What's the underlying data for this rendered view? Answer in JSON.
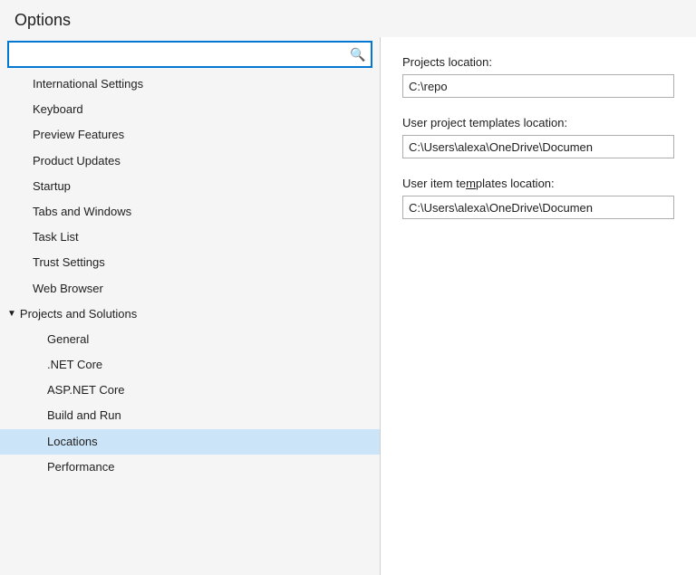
{
  "dialog": {
    "title": "Options"
  },
  "search": {
    "placeholder": "",
    "value": "",
    "icon": "🔍"
  },
  "tree": {
    "items": [
      {
        "id": "international-settings",
        "label": "International Settings",
        "level": "root",
        "selected": false
      },
      {
        "id": "keyboard",
        "label": "Keyboard",
        "level": "root",
        "selected": false
      },
      {
        "id": "preview-features",
        "label": "Preview Features",
        "level": "root",
        "selected": false
      },
      {
        "id": "product-updates",
        "label": "Product Updates",
        "level": "root",
        "selected": false
      },
      {
        "id": "startup",
        "label": "Startup",
        "level": "root",
        "selected": false
      },
      {
        "id": "tabs-and-windows",
        "label": "Tabs and Windows",
        "level": "root",
        "selected": false
      },
      {
        "id": "task-list",
        "label": "Task List",
        "level": "root",
        "selected": false
      },
      {
        "id": "trust-settings",
        "label": "Trust Settings",
        "level": "root",
        "selected": false
      },
      {
        "id": "web-browser",
        "label": "Web Browser",
        "level": "root",
        "selected": false
      },
      {
        "id": "projects-and-solutions",
        "label": "Projects and Solutions",
        "level": "group",
        "expanded": true,
        "selected": false
      },
      {
        "id": "general",
        "label": "General",
        "level": "child",
        "selected": false
      },
      {
        "id": "net-core",
        "label": ".NET Core",
        "level": "child",
        "selected": false
      },
      {
        "id": "aspnet-core",
        "label": "ASP.NET Core",
        "level": "child",
        "selected": false
      },
      {
        "id": "build-and-run",
        "label": "Build and Run",
        "level": "child",
        "selected": false
      },
      {
        "id": "locations",
        "label": "Locations",
        "level": "child",
        "selected": true
      },
      {
        "id": "performance",
        "label": "Performance",
        "level": "child",
        "selected": false
      }
    ]
  },
  "right_panel": {
    "fields": [
      {
        "id": "projects-location",
        "label": "Projects location:",
        "value": "C:\\repo",
        "underline_char": ""
      },
      {
        "id": "user-project-templates-location",
        "label": "User project templates location:",
        "value": "C:\\Users\\alexa\\OneDrive\\Documen",
        "underline_char": ""
      },
      {
        "id": "user-item-templates-location",
        "label": "User item templates location:",
        "value": "C:\\Users\\alexa\\OneDrive\\Documen",
        "underline_char": "n"
      }
    ]
  }
}
